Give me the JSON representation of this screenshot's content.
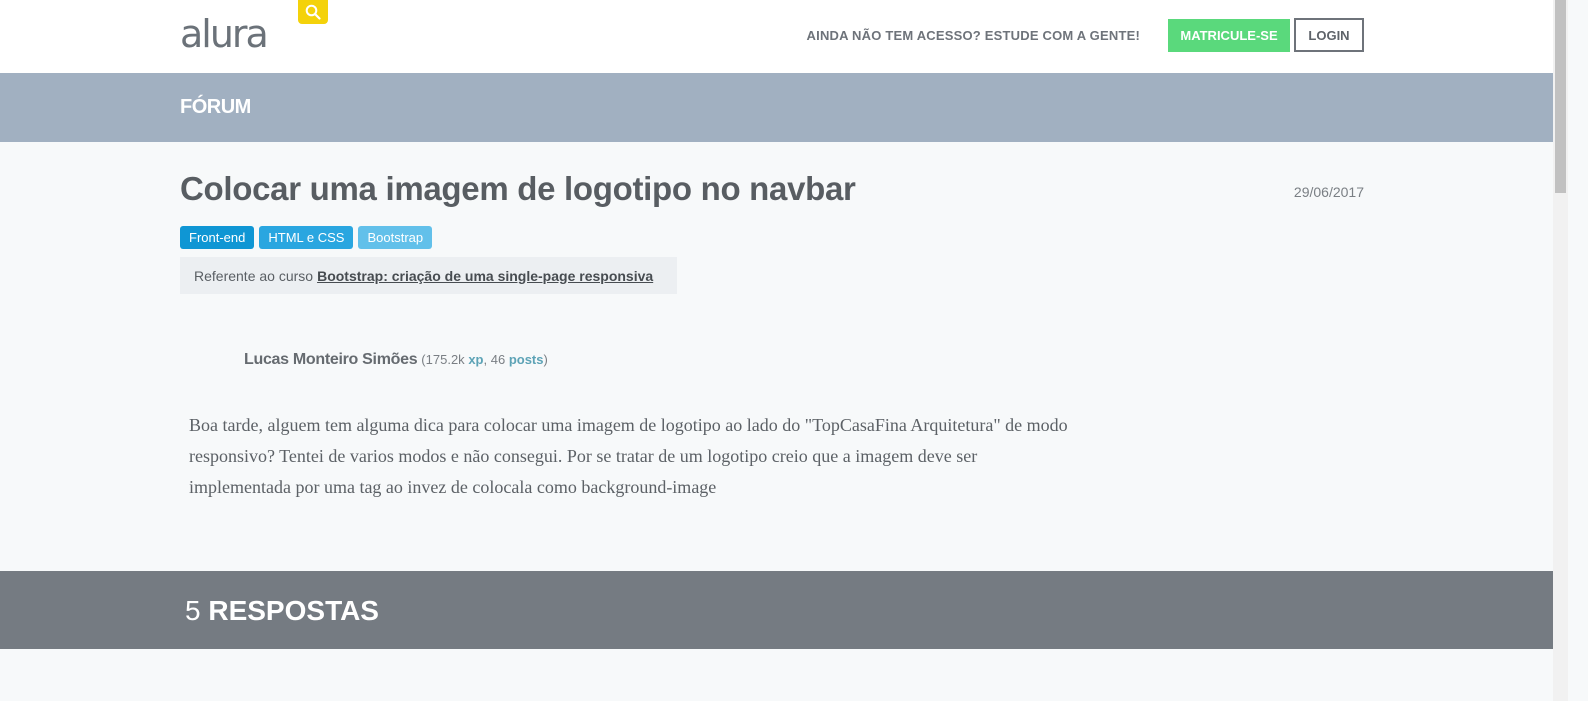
{
  "header": {
    "logo_text": "alura",
    "cta_text": "AINDA NÃO TEM ACESSO? ESTUDE COM A GENTE!",
    "enroll_label": "MATRICULE-SE",
    "login_label": "LOGIN",
    "accent_color": "#5ad97c",
    "search_color": "#f4d20a"
  },
  "section": {
    "title": "FÓRUM"
  },
  "topic": {
    "title": "Colocar uma imagem de logotipo no navbar",
    "date": "29/06/2017",
    "tags": [
      "Front-end",
      "HTML e CSS",
      "Bootstrap"
    ],
    "course_prefix": "Referente ao curso",
    "course_name": "Bootstrap: criação de uma single-page responsiva"
  },
  "author": {
    "name": "Lucas Monteiro Simões",
    "xp_value": "175.2k",
    "xp_label": "xp",
    "posts_count": "46",
    "posts_label": "posts"
  },
  "post": {
    "body": "Boa tarde, alguem tem alguma dica para colocar uma imagem de logotipo ao lado do \"TopCasaFina Arquitetura\" de modo responsivo? Tentei de varios modos e não consegui. Por se tratar de um logotipo creio que a imagem deve ser implementada por uma tag ao invez de colocala como background-image"
  },
  "answers": {
    "count": "5",
    "label": "RESPOSTAS"
  }
}
